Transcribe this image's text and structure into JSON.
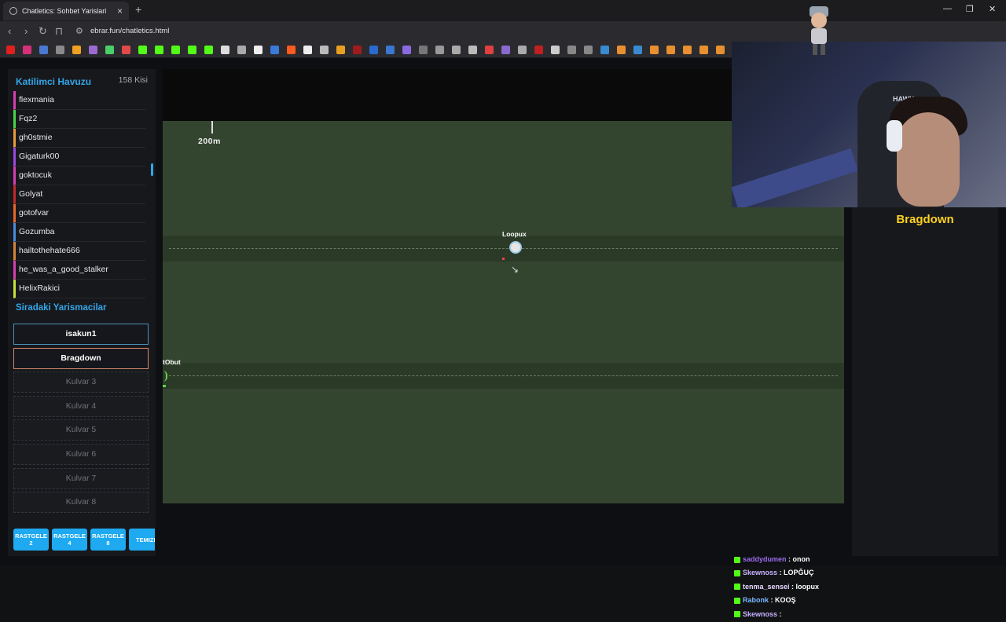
{
  "browser": {
    "tab_title": "Chatletics: Sohbet Yarislari",
    "url": "ebrar.fun/chatletics.html"
  },
  "pool": {
    "title": "Katilimci Havuzu",
    "count": "158 Kisi",
    "participants": [
      {
        "name": "flexmania",
        "color": "#d63fb0"
      },
      {
        "name": "Fqz2",
        "color": "#48d64b"
      },
      {
        "name": "gh0stmie",
        "color": "#e89a3d"
      },
      {
        "name": "Gigaturk00",
        "color": "#9b47e0"
      },
      {
        "name": "goktocuk",
        "color": "#d63fb0"
      },
      {
        "name": "Golyat",
        "color": "#c02a2a"
      },
      {
        "name": "gotofvar",
        "color": "#e8682c"
      },
      {
        "name": "Gozumba",
        "color": "#4a8be0"
      },
      {
        "name": "hailtothehate666",
        "color": "#d6843a"
      },
      {
        "name": "he_was_a_good_stalker",
        "color": "#d63fb0"
      },
      {
        "name": "HelixRakici",
        "color": "#c8e03a"
      }
    ]
  },
  "queue": {
    "title": "Siradaki Yarismacilar",
    "slots": [
      "isakun1",
      "Bragdown",
      "Kulvar 3",
      "Kulvar 4",
      "Kulvar 5",
      "Kulvar 6",
      "Kulvar 7",
      "Kulvar 8"
    ]
  },
  "random_buttons": [
    {
      "line1": "RASTGELE",
      "line2": "2"
    },
    {
      "line1": "RASTGELE",
      "line2": "4"
    },
    {
      "line1": "RASTGELE",
      "line2": "8"
    },
    {
      "line1": "TEMIZL",
      "line2": ""
    }
  ],
  "race": {
    "distance_label": "200m",
    "racer1": "Loopux",
    "racer2": "tObut"
  },
  "winner": "Bragdown",
  "chat": [
    {
      "user": "saddydumen",
      "msg": "onon",
      "color": "#9b6cf0"
    },
    {
      "user": "Skewnoss",
      "msg": "LOPĞUÇ",
      "color": "#c9b3ff"
    },
    {
      "user": "tenma_sensei",
      "msg": "loopux",
      "color": "#e8d9ff"
    },
    {
      "user": "Rabonk",
      "msg": "KOOŞ",
      "color": "#7ab8ff"
    },
    {
      "user": "Skewnoss",
      "msg": "",
      "color": "#c9b3ff"
    }
  ],
  "webcam_logo": "HAWK"
}
